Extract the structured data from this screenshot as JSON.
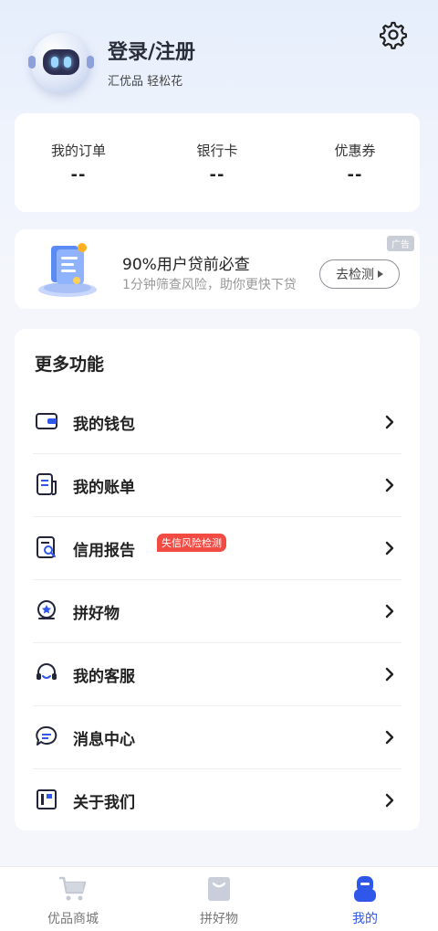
{
  "header": {
    "login_title": "登录/注册",
    "tagline": "汇优品 轻松花"
  },
  "stats": [
    {
      "label": "我的订单",
      "value": "--"
    },
    {
      "label": "银行卡",
      "value": "--"
    },
    {
      "label": "优惠券",
      "value": "--"
    }
  ],
  "ad": {
    "tag": "广告",
    "title": "90%用户贷前必查",
    "subtitle": "1分钟筛查风险，助你更快下贷",
    "button": "去检测"
  },
  "more": {
    "title": "更多功能",
    "items": [
      {
        "label": "我的钱包",
        "icon": "wallet-icon"
      },
      {
        "label": "我的账单",
        "icon": "bill-icon"
      },
      {
        "label": "信用报告",
        "icon": "credit-report-icon",
        "badge": "失信风险检测"
      },
      {
        "label": "拼好物",
        "icon": "group-buy-icon"
      },
      {
        "label": "我的客服",
        "icon": "customer-service-icon"
      },
      {
        "label": "消息中心",
        "icon": "message-icon"
      },
      {
        "label": "关于我们",
        "icon": "about-icon"
      }
    ]
  },
  "tabs": [
    {
      "label": "优品商城",
      "icon": "cart-icon"
    },
    {
      "label": "拼好物",
      "icon": "bag-icon"
    },
    {
      "label": "我的",
      "icon": "user-icon",
      "active": true
    }
  ],
  "colors": {
    "accent": "#2f57e9",
    "badge": "#f14b43"
  }
}
